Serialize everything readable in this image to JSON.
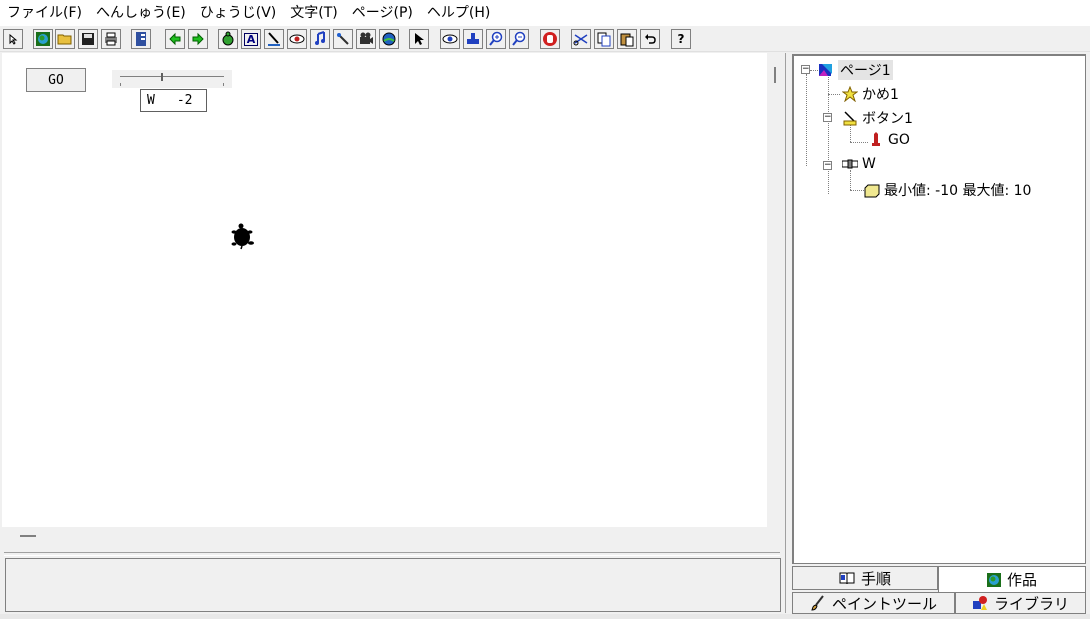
{
  "menu": [
    "ファイル(F)",
    "へんしゅう(E)",
    "ひょうじ(V)",
    "文字(T)",
    "ページ(P)",
    "ヘルプ(H)"
  ],
  "toolbar": {
    "icons": [
      "pointer-mode-icon",
      "globe-icon",
      "open-folder-icon",
      "save-icon",
      "print-icon",
      "notebook-icon",
      "back-arrow-icon",
      "forward-arrow-icon",
      "turtle-icon",
      "text-a-icon",
      "pen-icon",
      "eye-icon",
      "music-icon",
      "magic-wand-icon",
      "film-icon",
      "planet-icon",
      "arrow-cursor-icon",
      "watch-eye-icon",
      "stamp-icon",
      "zoom-in-icon",
      "zoom-out-icon",
      "stop-hand-icon",
      "scissors-icon",
      "copy-icon",
      "paste-icon",
      "undo-icon",
      "help-icon"
    ],
    "help_glyph": "?",
    "text_glyph": "A"
  },
  "canvas": {
    "go_button": "GO",
    "slider": {
      "name": "W",
      "value": "-2",
      "level": -2,
      "min": -10,
      "max": 10
    }
  },
  "tree": {
    "page": "ページ1",
    "turtle": "かめ1",
    "button": "ボタン1",
    "button_child": "GO",
    "slider": "W",
    "slider_child": "最小値: -10  最大値: 10"
  },
  "tabs": {
    "top": [
      "手順",
      "作品"
    ],
    "bottom": [
      "ペイントツール",
      "ライブラリ"
    ]
  }
}
